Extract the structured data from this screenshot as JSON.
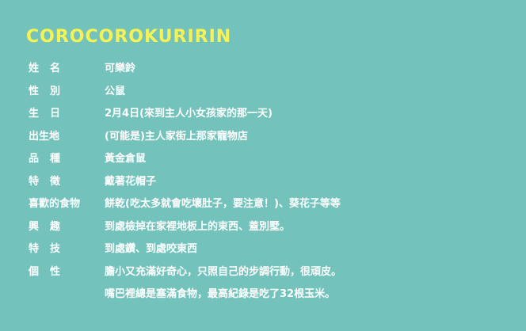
{
  "title": "COROCOROKURIRIN",
  "rows": [
    {
      "label": "姓名",
      "value": "可樂鈴"
    },
    {
      "label": "性別",
      "value": "公鼠"
    },
    {
      "label": "生日",
      "value": "2月4日(來到主人小女孩家的那一天)"
    },
    {
      "label": "出生地",
      "value": "(可能是)主人家街上那家寵物店"
    },
    {
      "label": "品種",
      "value": "黃金倉鼠"
    },
    {
      "label": "特徵",
      "value": "戴著花帽子"
    },
    {
      "label": "喜歡的食物",
      "value": "餅乾(吃太多就會吃壞肚子，要注意！)、葵花子等等"
    },
    {
      "label": "興趣",
      "value": "到處檢掉在家裡地板上的東西、蓋別墅。"
    },
    {
      "label": "特技",
      "value": "到處鑽、到處咬東西"
    },
    {
      "label": "個性",
      "value": "膽小又充滿好奇心，只照自己的步調行動，很頑皮。"
    }
  ],
  "continuation": "嘴巴裡總是塞滿食物，最高紀錄是吃了32根玉米。"
}
